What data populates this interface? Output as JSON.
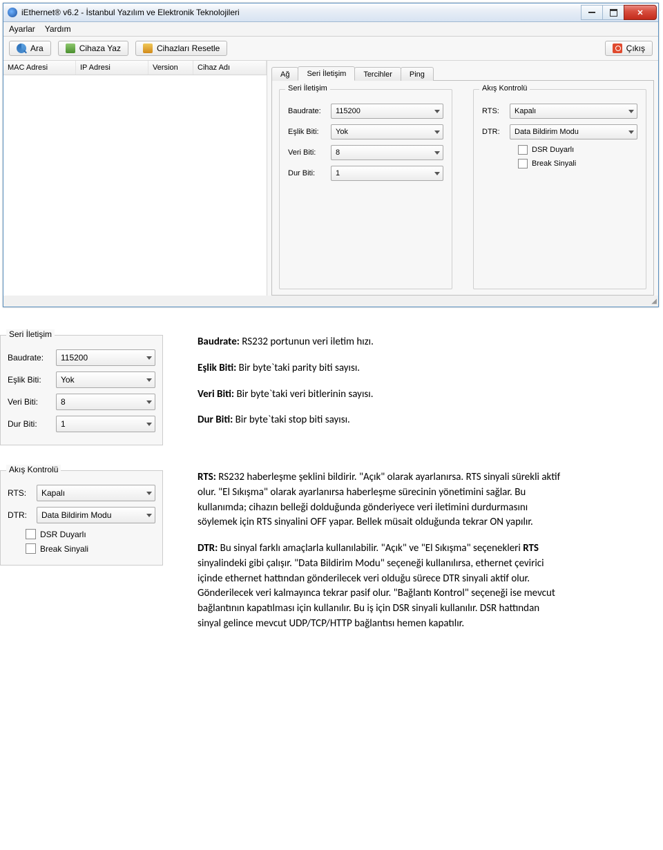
{
  "window": {
    "title": "iEthernet® v6.2 - İstanbul Yazılım ve Elektronik Teknolojileri"
  },
  "menu": {
    "settings": "Ayarlar",
    "help": "Yardım"
  },
  "toolbar": {
    "search": "Ara",
    "write": "Cihaza Yaz",
    "reset": "Cihazları Resetle",
    "exit": "Çıkış"
  },
  "device_table": {
    "cols": {
      "mac": "MAC Adresi",
      "ip": "IP Adresi",
      "version": "Version",
      "name": "Cihaz Adı"
    }
  },
  "tabs": {
    "network": "Ağ",
    "serial": "Seri İletişim",
    "prefs": "Tercihler",
    "ping": "Ping"
  },
  "serial": {
    "group_title": "Seri İletişim",
    "baudrate_label": "Baudrate:",
    "baudrate_value": "115200",
    "parity_label": "Eşlik Biti:",
    "parity_value": "Yok",
    "databits_label": "Veri Biti:",
    "databits_value": "8",
    "stopbits_label": "Dur Biti:",
    "stopbits_value": "1"
  },
  "flow": {
    "group_title": "Akış Kontrolü",
    "rts_label": "RTS:",
    "rts_value": "Kapalı",
    "dtr_label": "DTR:",
    "dtr_value": "Data Bildirim Modu",
    "dsr_label": "DSR Duyarlı",
    "break_label": "Break Sinyali"
  },
  "doc": {
    "serial_img": {
      "title": "Seri İletişim",
      "baud_l": "Baudrate:",
      "baud_v": "115200",
      "par_l": "Eşlik Biti:",
      "par_v": "Yok",
      "data_l": "Veri Biti:",
      "data_v": "8",
      "stop_l": "Dur Biti:",
      "stop_v": "1"
    },
    "flow_img": {
      "title": "Akış Kontrolü",
      "rts_l": "RTS:",
      "rts_v": "Kapalı",
      "dtr_l": "DTR:",
      "dtr_v": "Data Bildirim Modu",
      "dsr": "DSR Duyarlı",
      "brk": "Break Sinyali"
    },
    "p_baud": "RS232 portunun veri iletim hızı.",
    "p_baud_b": "Baudrate: ",
    "p_parity": "Bir byte`taki parity biti sayısı.",
    "p_parity_b": "Eşlik Biti: ",
    "p_databits": "Bir byte`taki veri bitlerinin sayısı.",
    "p_databits_b": "Veri Biti: ",
    "p_stopbits": "Bir byte`taki stop biti sayısı.",
    "p_stopbits_b": "Dur Biti: ",
    "rts_b": "RTS: ",
    "rts_text": "RS232 haberleşme şeklini bildirir. \"Açık\" olarak ayarlanırsa. RTS sinyali sürekli aktif olur. \"El Sıkışma\" olarak ayarlanırsa haberleşme sürecinin yönetimini sağlar. Bu kullanımda; cihazın belleği dolduğunda gönderiyece veri iletimini durdurmasını söylemek için RTS sinyalini OFF yapar. Bellek müsait olduğunda tekrar ON yapılır.",
    "dtr_b": "DTR: ",
    "dtr_text1": "Bu sinyal farklı amaçlarla kullanılabilir. \"Açık\" ve \"El Sıkışma\" seçenekleri ",
    "dtr_bold_inner": "RTS ",
    "dtr_text2": "sinyalindeki gibi çalışır. \"Data Bildirim Modu\" seçeneği kullanılırsa, ethernet çevirici içinde ethernet hattından gönderilecek veri olduğu sürece DTR sinyali aktif olur. Gönderilecek veri kalmayınca tekrar pasif olur. \"Bağlantı Kontrol\" seçeneği ise mevcut bağlantının kapatılması için kullanılır. Bu iş için DSR sinyali kullanılır. DSR hattından sinyal gelince mevcut UDP/TCP/HTTP bağlantısı hemen kapatılır."
  }
}
